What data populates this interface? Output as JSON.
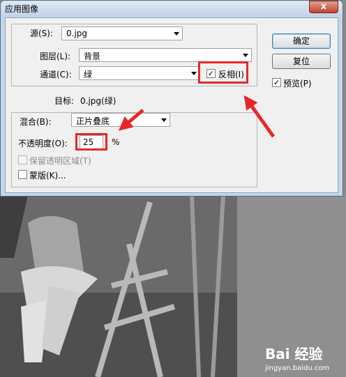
{
  "window": {
    "title": "应用图像",
    "close_glyph": "x"
  },
  "source": {
    "label": "源(S):",
    "value": "0.jpg"
  },
  "layer": {
    "label": "图层(L):",
    "value": "背景"
  },
  "channel": {
    "label": "通道(C):",
    "value": "绿"
  },
  "invert": {
    "label": "反相(I)",
    "checked": true,
    "checkmark": "✓"
  },
  "target": {
    "label": "目标:",
    "value": "0.jpg(绿)"
  },
  "blending": {
    "label": "混合(B):",
    "value": "正片叠底"
  },
  "opacity": {
    "label": "不透明度(O):",
    "value": "25",
    "unit": "%"
  },
  "preserve_transparency": {
    "label": "保留透明区域(T)",
    "enabled": false,
    "checked": false
  },
  "mask": {
    "label": "蒙版(K)...",
    "checked": false
  },
  "buttons": {
    "ok": "确定",
    "reset": "复位"
  },
  "preview": {
    "label": "预览(P)",
    "checked": true,
    "checkmark": "✓"
  },
  "watermark": {
    "logo": "Bai 经验",
    "url": "jingyan.baidu.com"
  },
  "colors": {
    "annotation": "#e8262a"
  }
}
